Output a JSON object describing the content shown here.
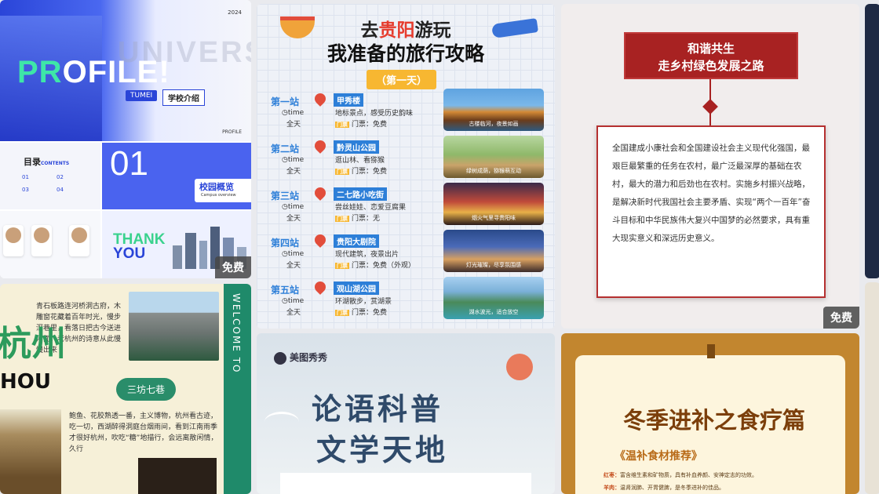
{
  "free_label": "免费",
  "profile": {
    "year": "2024",
    "watermark": "UNIVERS",
    "title_a": "PR",
    "title_b": "OFILE!",
    "brand": "TUMEI",
    "school": "学校介绍",
    "footer": "PROFILE",
    "contents_title": "目录",
    "contents_sub": "CONTENTS",
    "item_01": "01",
    "item_02": "02",
    "item_03": "03",
    "item_04": "04",
    "big_num": "01",
    "campus": "校园概览",
    "campus_en": "Campus overview",
    "thank": "THANK",
    "you": "YOU"
  },
  "guiyang": {
    "title_a": "去",
    "title_b": "贵阳",
    "title_c": "游玩",
    "title2": "我准备的旅行攻略",
    "day": "（第一天）",
    "stops": [
      {
        "label": "第一站",
        "time": "time",
        "all_day": "全天",
        "place": "甲秀楼",
        "desc": "地标景点，感受历史韵味",
        "ticket_tag": "门票",
        "ticket": "门票：免费",
        "caption": "古楼临河，夜景如画"
      },
      {
        "label": "第二站",
        "time": "time",
        "all_day": "全天",
        "place": "黔灵山公园",
        "desc": "逛山林、看猕猴",
        "ticket_tag": "门票",
        "ticket": "门票：免费",
        "caption": "绿树成荫，猕猴萌互动"
      },
      {
        "label": "第三站",
        "time": "time",
        "all_day": "全天",
        "place": "二七路小吃街",
        "desc": "尝丝娃娃、恋爱豆腐果",
        "ticket_tag": "门票",
        "ticket": "门票：无",
        "caption": "烟火气里寻贵阳味"
      },
      {
        "label": "第四站",
        "time": "time",
        "all_day": "全天",
        "place": "贵阳大剧院",
        "desc": "现代建筑，夜景出片",
        "ticket_tag": "门票",
        "ticket": "门票：免费（外观）",
        "caption": "灯光璀璨，尽享氛围感"
      },
      {
        "label": "第五站",
        "time": "time",
        "all_day": "全天",
        "place": "观山湖公园",
        "desc": "环湖散步，赏湖景",
        "ticket_tag": "门票",
        "ticket": "门票：免费",
        "caption": "湖水波光，适合放空"
      }
    ]
  },
  "harmony": {
    "line1": "和谐共生",
    "line2": "走乡村绿色发展之路",
    "body": "全国建成小康社会和全国建设社会主义现代化强国，最艰巨最繁重的任务在农村，最广泛最深厚的基础在农村，最大的潜力和后劲也在农村。实施乡村振兴战略，是解决新时代我国社会主要矛盾、实现“两个一百年”奋斗目标和中华民族伟大复兴中国梦的必然要求，具有重大现实意义和深远历史意义。"
  },
  "hangzhou": {
    "welcome": "WELCOME TO",
    "big": "杭州",
    "zhou": "HOU",
    "text1": "青石板路连河桥洞古府，木雕窗花藏着百年时光，慢步深巷里，看落日把古今送进河面，老杭州的诗意从此慢慢出来",
    "tag": "三坊七巷",
    "text2": "鲍鱼、花胶熟透一番，主义博物，杭州看古迹，吃一切，西湖醉得洞庭台烟雨间，看到江南雨季才很好杭州，吹吃“糖”地描行，会远离散闲情，久行"
  },
  "lunyu": {
    "brand": "美图秀秀",
    "line1": "论语科普",
    "line2": "文学天地"
  },
  "winter": {
    "title": "冬季进补之食疗篇",
    "sub": "《温补食材推荐》",
    "item1_k": "红枣：",
    "item1_v": "富含维生素和矿物质，具有补血养颜、安神定志的功效。",
    "item2_k": "羊肉：",
    "item2_v": "温肾润肺、开胃健脾，是冬季进补的佳品。"
  }
}
